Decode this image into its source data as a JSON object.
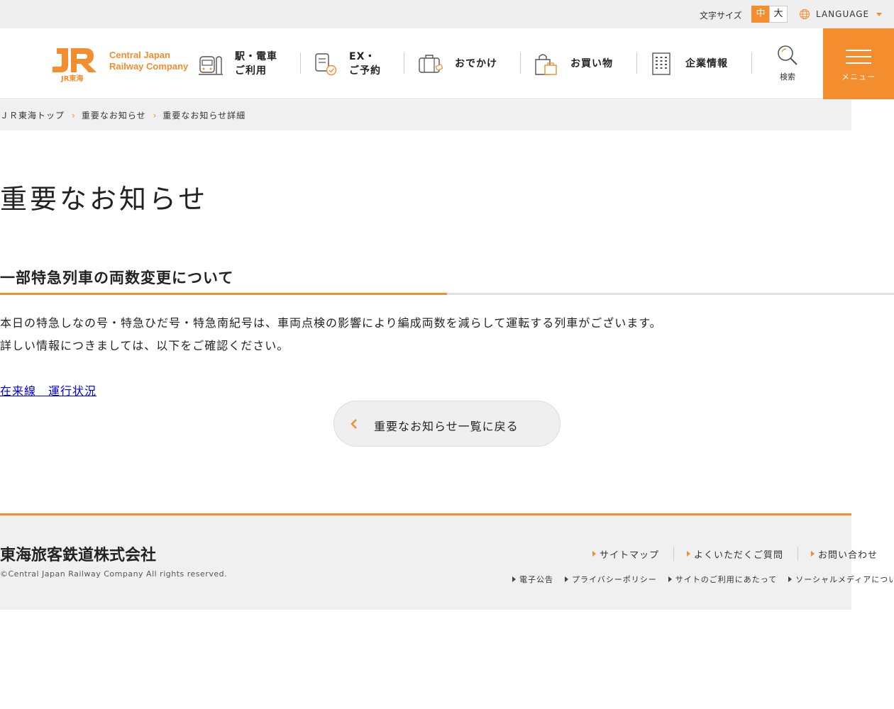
{
  "utility": {
    "font_size_label": "文字サイズ",
    "font_size_options": [
      "中",
      "大"
    ],
    "language_label": "LANGUAGE"
  },
  "header": {
    "logo_text_line1": "Central Japan",
    "logo_text_line2": "Railway Company",
    "logo_mark_sub": "JR東海",
    "nav": [
      {
        "label": "駅・電車\nご利用",
        "icon": "train-station-icon"
      },
      {
        "label": "EX・\nご予約",
        "icon": "ticket-reservation-icon"
      },
      {
        "label": "おでかけ",
        "icon": "suitcase-icon"
      },
      {
        "label": "お買い物",
        "icon": "shopping-bag-icon"
      },
      {
        "label": "企業情報",
        "icon": "building-icon"
      }
    ],
    "search_label": "検索",
    "menu_label": "メニュー"
  },
  "breadcrumb": [
    "ＪＲ東海トップ",
    "重要なお知らせ",
    "重要なお知らせ詳細"
  ],
  "main": {
    "page_title": "重要なお知らせ",
    "notice_title": "一部特急列車の両数変更について",
    "body_lines": [
      "本日の特急しなの号・特急ひだ号・特急南紀号は、車両点検の影響により編成両数を減らして運転する列車がございます。",
      "詳しい情報につきましては、以下をご確認ください。"
    ],
    "link_text": "在来線　運行状況",
    "back_button": "重要なお知らせ一覧に戻る"
  },
  "footer": {
    "company": "東海旅客鉄道株式会社",
    "copyright": "©Central Japan Railway Company All rights reserved.",
    "primary_links": [
      "サイトマップ",
      "よくいただくご質問",
      "お問い合わせ"
    ],
    "secondary_links": [
      "電子公告",
      "プライバシーポリシー",
      "サイトのご利用にあたって",
      "ソーシャルメディアについて"
    ]
  },
  "colors": {
    "accent": "#f38d2e",
    "bg_grey": "#f0f0f0"
  }
}
